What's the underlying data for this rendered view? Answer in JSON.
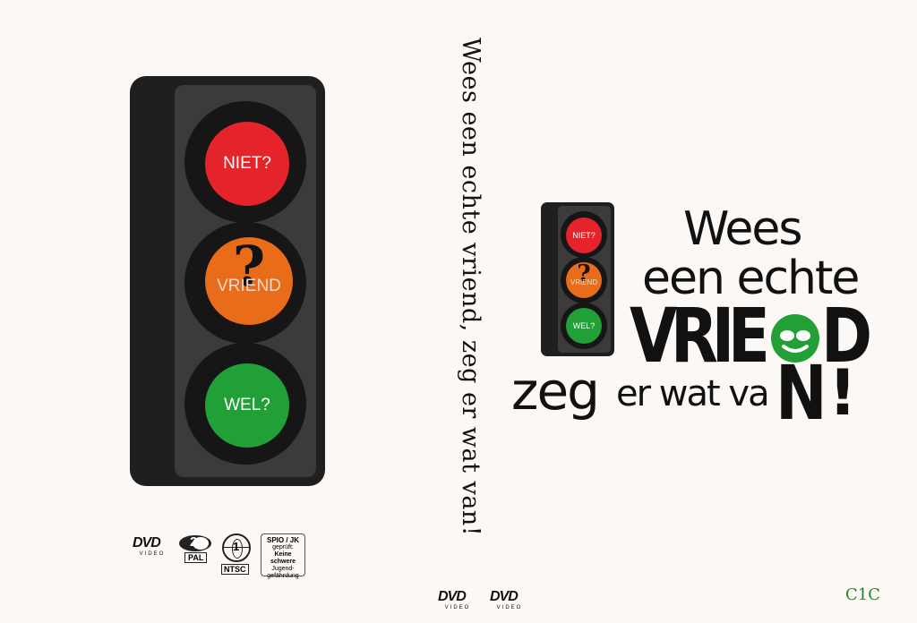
{
  "back_cover": {
    "light": {
      "red_label": "NIET?",
      "orange_label": "VRIEND",
      "orange_mark": "?",
      "green_label": "WEL?"
    },
    "logos": {
      "dvd_video_text": "DVD",
      "dvd_video_sub": "VIDEO",
      "region_number": "2",
      "region_sub": "PAL",
      "ntsc_number": "1",
      "ntsc_sub": "NTSC",
      "spio_line1": "SPIO / JK",
      "spio_line2": "geprüft:",
      "spio_line3": "Keine schwere",
      "spio_line4": "Jugend-",
      "spio_line5": "gefährdung"
    }
  },
  "spine": {
    "title": "Wees een echte vriend, zeg er wat van!",
    "dvd1_text": "DVD",
    "dvd1_sub": "VIDEO",
    "dvd2_text": "DVD",
    "dvd2_sub": "VIDEO"
  },
  "front_cover": {
    "light": {
      "red_label": "NIET?",
      "orange_label": "VRIEND",
      "orange_mark": "?",
      "green_label": "WEL?"
    },
    "line1": "Wees",
    "line2": "een echte",
    "vrie": "VRIE",
    "d": "D",
    "n": "N",
    "exclaim": "!",
    "zeg": "zeg",
    "er_wat_va": "er wat va"
  },
  "corner_code": "C1C",
  "colors": {
    "red": "#e4232b",
    "orange": "#e86c1a",
    "green": "#21a038",
    "smiley": "#22a035"
  }
}
